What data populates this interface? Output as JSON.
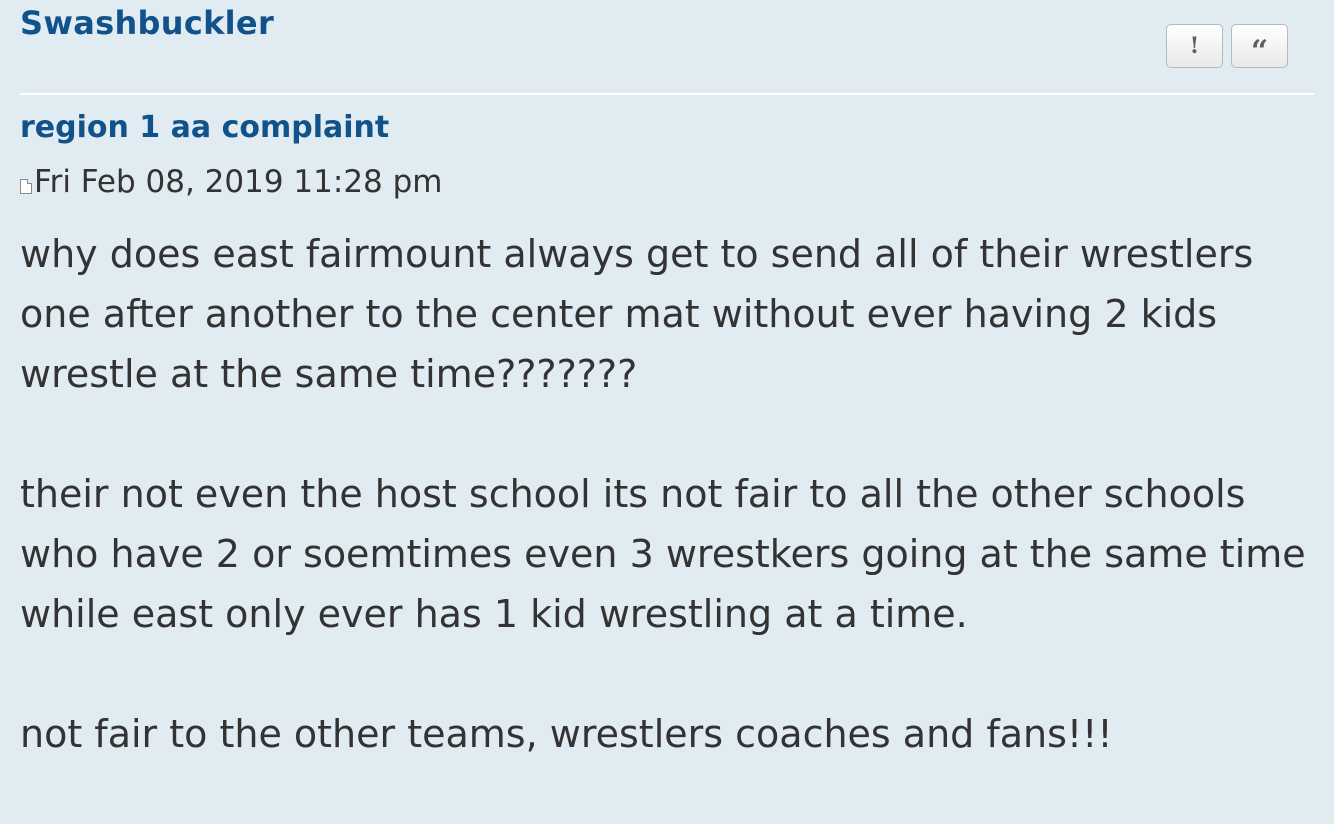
{
  "post": {
    "author": "Swashbuckler",
    "buttons": {
      "report_symbol": "!",
      "quote_symbol": "“"
    },
    "title": "region 1 aa complaint",
    "date": "Fri Feb 08, 2019 11:28 pm",
    "icon": "post-file-icon",
    "paragraphs": [
      "why does east fairmount always get to send all of their wrestlers one after another to the center mat without ever having 2 kids wrestle at the same time???????",
      "their not even the host school its not fair to all the other schools who have 2 or soemtimes even 3 wrestkers going at the same time while east only ever has 1 kid wrestling at a time.",
      "not fair to the other teams, wrestlers coaches and fans!!!"
    ]
  },
  "colors": {
    "background": "#e1ebf2",
    "link": "#105289",
    "text": "#333333",
    "divider": "#ffffff"
  }
}
